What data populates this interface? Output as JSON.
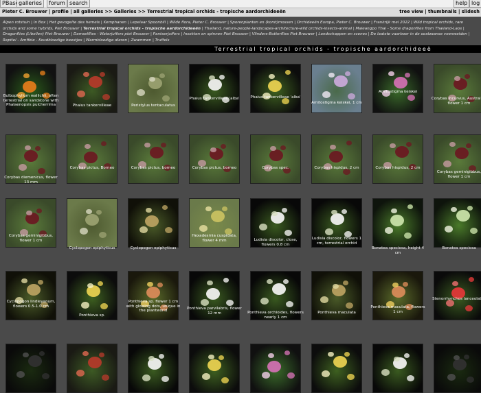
{
  "topbar": {
    "left_buttons": [
      "PBase",
      "galleries",
      "forum",
      "search"
    ],
    "right_buttons": [
      "help",
      "log"
    ]
  },
  "breadcrumb": {
    "path": "Pieter C. Brouwer | profile | all galleries >> Galleries >> Terrestrial tropical orchids - tropische aardorchideeën",
    "views": "tree view | thumbnails | slidesh"
  },
  "gallery_list": {
    "before": "Alpen rotstuin | In Box | Het gevogelte des hemels | Kemphanen | Lepelaar Spoonbill | Wilde flora, Pieter C. Brouwer | Sporenplanten en (korst)mossen | Orchideeën Europa, Pieter C. Brouwer | Frankrijk mei 2022 | Wild tropical orchids, rare orchids and some hybrids, Piet Brouwer | ",
    "current": "Terrestrial tropical orchids - tropische aardorchideeën",
    "after": " | Thailand, nature-people-landscapes-architecture-wild orchids-insects-animal | Maleangpo Thai - Some dragonflies from Thailand-Laos | Dragonflies (Libellen) Piet Brouwer | Damselflies - Waterjuffers piet Brouwer | Pantserjuffers | Insekten en spinnen Piet Brouwer | Vlinders-Butterflies Piet Brouwer | Landschappen en scenes | De laatste vaarboer in de oostzaanse veenweiden | Reptiel - Amfibie - Koudbloedige beestjes | Warmbloedige dieren | Zwammen | Truffels"
  },
  "gallery_title": "Terrestrial tropical orchids - tropische aardorchideeë",
  "colors": {
    "page_bg": "#4a4a4a",
    "title_bg": "#000000",
    "caption": "#ffffff"
  },
  "thumbnails": [
    {
      "caption": "Bulbophyllum wallichii, often terrestrial on sandstone with Phalaenopsis pulcherrima",
      "icon": "orange-orchid-photo"
    },
    {
      "caption": "Phaius tankervilleae",
      "icon": "red-orchid-photo"
    },
    {
      "caption": "Peristylus tentaculatus",
      "icon": "grass-orchid-photo"
    },
    {
      "caption": "Phaius tankervilleae 'alba'",
      "icon": "white-orchid-photo"
    },
    {
      "caption": "Phaius tankervilleae 'alba'",
      "icon": "yellow-orchid-photo"
    },
    {
      "caption": "Amitostigma keiskei, 1 cm",
      "icon": "lilac-orchid-photo"
    },
    {
      "caption": "Amitostigma keiskei",
      "icon": "pink-orchid-photo"
    },
    {
      "caption": "Corybas incurvus, Australia , flower 1 cm",
      "icon": "corybas-photo"
    },
    {
      "caption": "Corybas diemenicus, flower 13 mm",
      "icon": "corybas-photo"
    },
    {
      "caption": "Corybas pictus, Borneo",
      "icon": "corybas-photo"
    },
    {
      "caption": "Corybas pictus, borneo",
      "icon": "corybas-photo"
    },
    {
      "caption": "Corybas pictus, borneo",
      "icon": "corybas-photo"
    },
    {
      "caption": "Corybas spec.",
      "icon": "corybas-photo"
    },
    {
      "caption": "Corybas hispidus, 2 cm",
      "icon": "corybas-photo"
    },
    {
      "caption": "Corybas hispidus, 2 cm",
      "icon": "corybas-photo"
    },
    {
      "caption": "Corybas geminigibbus, flower 1 cm",
      "icon": "corybas-photo"
    },
    {
      "caption": "Corybas geminigibbus, flower 1 cm",
      "icon": "corybas-photo"
    },
    {
      "caption": "Cyclopogon epiphyticus",
      "icon": "grass-orchid-photo"
    },
    {
      "caption": "Cyclopogon epiphyticus",
      "icon": "stem-orchid-photo"
    },
    {
      "caption": "Hexadesmia cuspidata, flower 4 mm",
      "icon": "yellow-stem-photo"
    },
    {
      "caption": "Ludisia discolor, close, flowers 0.8 cm",
      "icon": "white-orchid-photo"
    },
    {
      "caption": "Ludisia discolor, flowers 1 cm, terrestrial orchid",
      "icon": "white-orchid-photo"
    },
    {
      "caption": "Bonatea speciosa, height 4 cm",
      "icon": "green-orchid-photo"
    },
    {
      "caption": "Bonatea speciosa",
      "icon": "green-orchid-photo"
    },
    {
      "caption": "Cyclopogon lindleyanum, flowers 0.5-1.0 cm",
      "icon": "stem-orchid-photo"
    },
    {
      "caption": "Ponthieva sp.",
      "icon": "yellow-orchid-photo"
    },
    {
      "caption": "Ponthieva sp. flower 1 cm with glowing dots, unique in the plantworld",
      "icon": "spotted-orchid-photo"
    },
    {
      "caption": "Ponthieva parvilabris, flower 12 mm",
      "icon": "white-orchid-photo"
    },
    {
      "caption": "Ponthieva orchioides, flowers nearly 1 cm",
      "icon": "white-orchid-photo"
    },
    {
      "caption": "Ponthieva maculata",
      "icon": "stem-orchid-photo"
    },
    {
      "caption": "Ponthieva maculata, flowers 1 cm",
      "icon": "spotted-orchid-photo"
    },
    {
      "caption": "Stenorrhynchos lanceolatus",
      "icon": "red-spike-photo"
    },
    {
      "caption": "",
      "icon": "dark-photo"
    },
    {
      "caption": "",
      "icon": "red-orchid-photo"
    },
    {
      "caption": "",
      "icon": "white-orchid-photo"
    },
    {
      "caption": "",
      "icon": "yellow-orchid-photo"
    },
    {
      "caption": "",
      "icon": "pink-orchid-photo"
    },
    {
      "caption": "",
      "icon": "yellow-orchid-photo"
    },
    {
      "caption": "",
      "icon": "white-orchid-photo"
    },
    {
      "caption": "",
      "icon": "dark-photo"
    }
  ]
}
